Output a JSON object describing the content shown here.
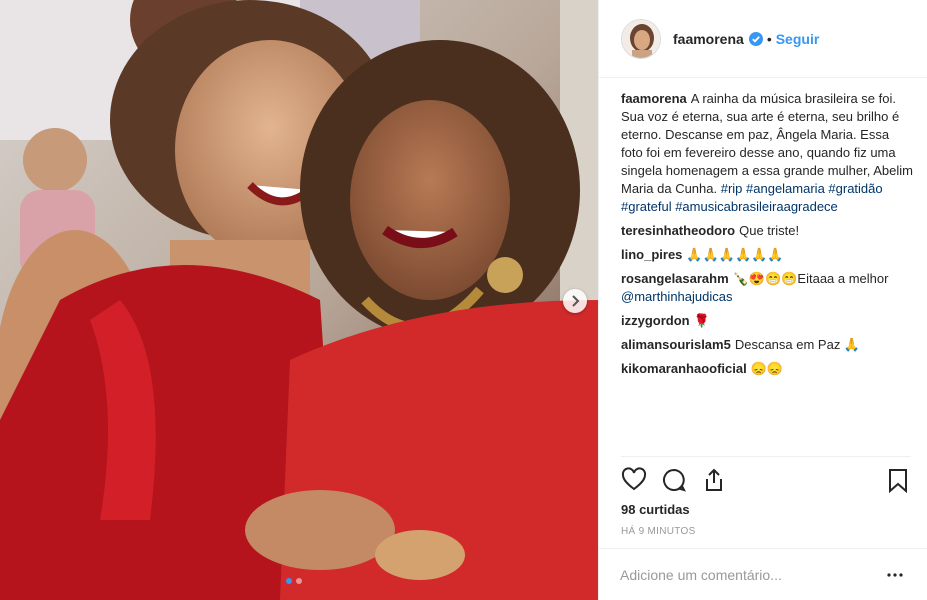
{
  "post": {
    "author": "faamorena",
    "separator": "•",
    "follow_label": "Seguir",
    "caption": {
      "user": "faamorena",
      "text": "A rainha da música brasileira se foi. Sua voz é eterna, sua arte é eterna, seu brilho é eterno. Descanse em paz, Ângela Maria. Essa foto foi em fevereiro desse ano, quando fiz uma singela homenagem a essa grande mulher, Abelim Maria da Cunha. ",
      "hashtags": "#rip #angelamaria #gratidão #grateful #amusicabrasileiraagradece"
    },
    "comments": [
      {
        "user": "teresinhatheodoro",
        "text": "Que triste!"
      },
      {
        "user": "lino_pires",
        "text": "🙏🙏🙏🙏🙏🙏"
      },
      {
        "user": "rosangelasarahm",
        "text": "🍾😍😁😁Eitaaa a melhor",
        "mention": "@marthinhajudicas"
      },
      {
        "user": "izzygordon",
        "text": "🌹"
      },
      {
        "user": "alimansourislam5",
        "text": "Descansa em Paz 🙏"
      },
      {
        "user": "kikomaranhaooficial",
        "text": "😞😞"
      }
    ],
    "likes": "98 curtidas",
    "time": "HÁ 9 MINUTOS",
    "add_comment_placeholder": "Adicione um comentário...",
    "icons": {
      "verified": "verified-badge-icon",
      "like": "heart-icon",
      "comment": "comment-bubble-icon",
      "share": "share-icon",
      "save": "bookmark-icon",
      "more": "more-options-icon",
      "next": "chevron-right-icon"
    },
    "colors": {
      "accent": "#3897f0",
      "link": "#003569",
      "muted": "#999999"
    }
  }
}
